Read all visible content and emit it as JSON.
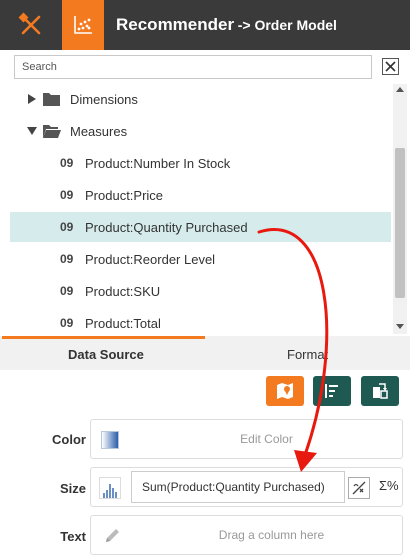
{
  "header": {
    "title": "Recommender",
    "subtitle": "-> Order Model",
    "left_icon": "pencil-ruler-icon",
    "active_icon": "scatter-chart-icon"
  },
  "search": {
    "placeholder": "Search",
    "value": ""
  },
  "tree": {
    "dimensions_label": "Dimensions",
    "measures_label": "Measures",
    "items": [
      {
        "type": "09",
        "label": "Product:Number In Stock"
      },
      {
        "type": "09",
        "label": "Product:Price"
      },
      {
        "type": "09",
        "label": "Product:Quantity Purchased",
        "selected": true
      },
      {
        "type": "09",
        "label": "Product:Reorder Level"
      },
      {
        "type": "09",
        "label": "Product:SKU"
      },
      {
        "type": "09",
        "label": "Product:Total"
      }
    ]
  },
  "tabs": {
    "data_source": "Data Source",
    "format": "Format"
  },
  "properties": {
    "color_label": "Color",
    "color_placeholder": "Edit Color",
    "size_label": "Size",
    "size_value": "Sum(Product:Quantity Purchased)",
    "sigma": "Σ%",
    "text_label": "Text",
    "text_placeholder": "Drag a column here"
  },
  "colors": {
    "accent": "#f47a20",
    "dark_button": "#1e5a52",
    "header_bg": "#3a3a3a",
    "selected_row": "#d6ecec",
    "arrow": "#e8190f"
  }
}
